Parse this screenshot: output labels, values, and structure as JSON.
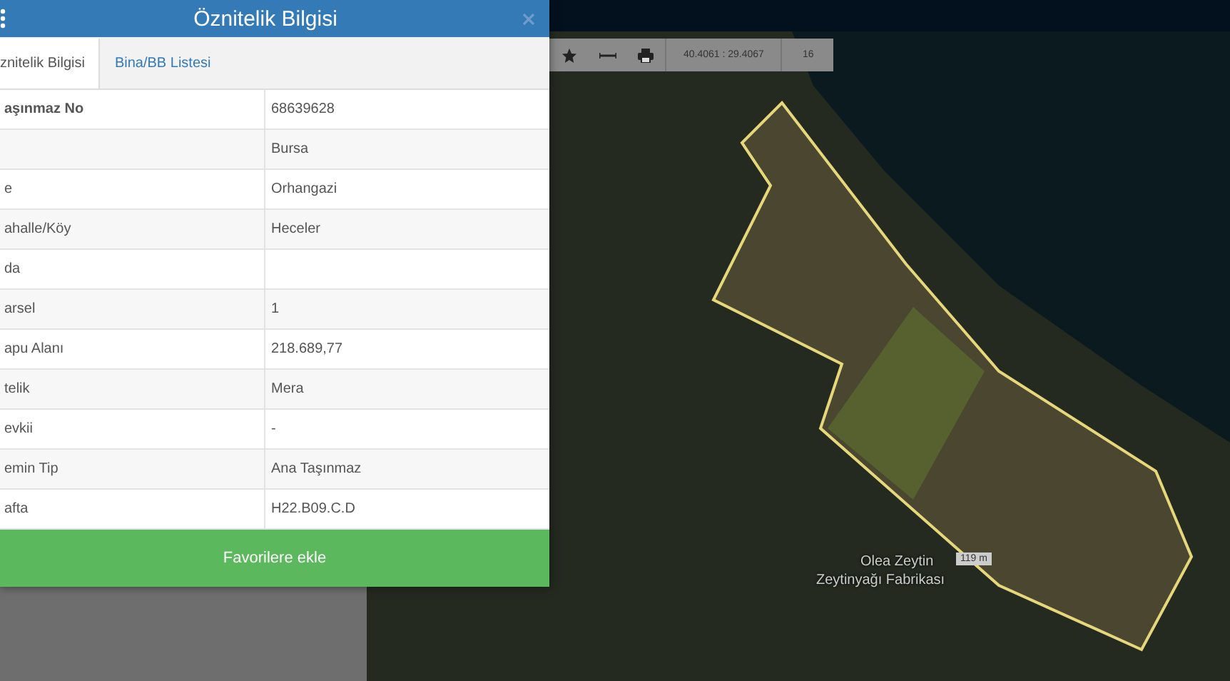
{
  "dialog": {
    "title": "Öznitelik Bilgisi",
    "tabs": [
      {
        "label": "znitelik Bilgisi",
        "selected": true
      },
      {
        "label": "Bina/BB Listesi",
        "selected": false
      }
    ],
    "rows": [
      {
        "label": "aşınmaz No",
        "value": "68639628"
      },
      {
        "value": "Bursa"
      },
      {
        "label": "e",
        "value": "Orhangazi"
      },
      {
        "label": "ahalle/Köy",
        "value": "Heceler"
      },
      {
        "label": "da"
      },
      {
        "label": "arsel",
        "value": "1"
      },
      {
        "label": "apu Alanı",
        "value": "218.689,77"
      },
      {
        "label": "telik",
        "value": "Mera"
      },
      {
        "label": "evkii",
        "value": "-"
      },
      {
        "label": "emin Tip",
        "value": "Ana Taşınmaz"
      },
      {
        "label": "afta",
        "value": "H22.B09.C.D"
      }
    ],
    "button": "Favorilere ekle"
  },
  "map_toolbar": {
    "coordinates": "40.4061 : 29.4067",
    "zoom": "16"
  },
  "map_labels": {
    "place_line_1": "Olea Zeytin",
    "place_line_2": "Zeytinyağı Fabrikası",
    "distance": "119 m"
  }
}
